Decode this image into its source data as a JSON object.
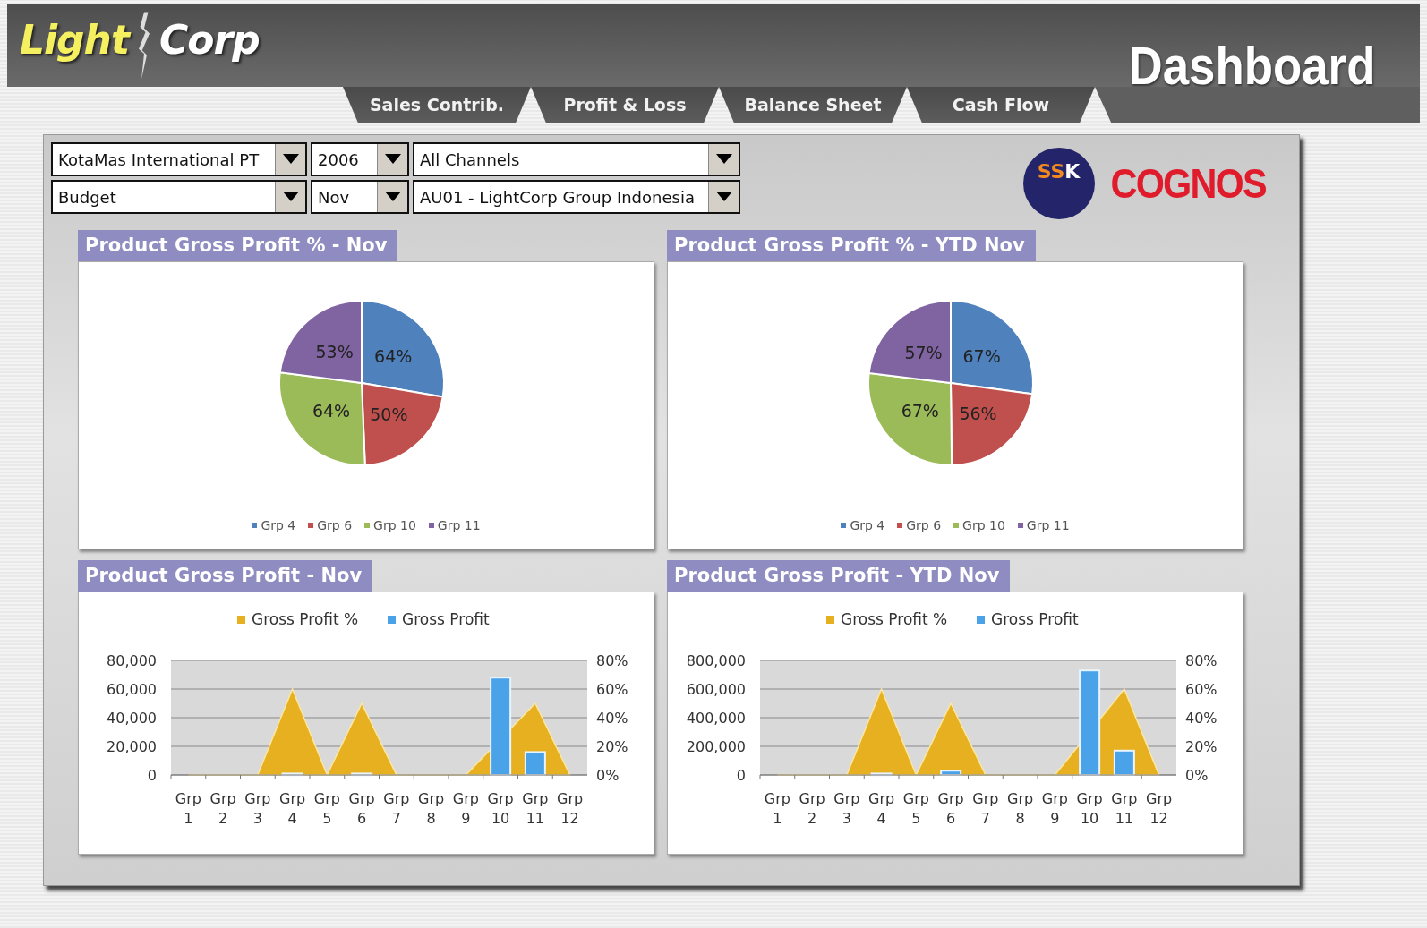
{
  "brand": {
    "first": "Light",
    "second": "Corp"
  },
  "title": "Dashboard",
  "tabs": [
    {
      "label": "Sales Contrib."
    },
    {
      "label": "Profit & Loss"
    },
    {
      "label": "Balance Sheet"
    },
    {
      "label": "Cash Flow"
    }
  ],
  "filters": [
    {
      "value": "KotaMas International PT"
    },
    {
      "value": "2006"
    },
    {
      "value": "All Channels"
    },
    {
      "value": "Budget"
    },
    {
      "value": "Nov"
    },
    {
      "value": "AU01 - LightCorp Group Indonesia"
    }
  ],
  "partner_logos": [
    {
      "kind": "circle",
      "text": "SSK"
    },
    {
      "kind": "wordmark",
      "text": "COGNOS"
    }
  ],
  "panels": [
    {
      "title": "Product Gross Profit % - Nov",
      "chart_data": {
        "type": "pie",
        "categories": [
          "Grp 4",
          "Grp 6",
          "Grp 10",
          "Grp 11"
        ],
        "values": [
          64,
          50,
          64,
          53
        ],
        "legend": "bottom",
        "value_labels": [
          "64%",
          "50%",
          "64%",
          "53%"
        ],
        "colors": [
          "#4f81bd",
          "#c0504d",
          "#9bbb59",
          "#8064a2"
        ]
      }
    },
    {
      "title": "Product Gross Profit % - YTD Nov",
      "chart_data": {
        "type": "pie",
        "categories": [
          "Grp 4",
          "Grp 6",
          "Grp 10",
          "Grp 11"
        ],
        "values": [
          67,
          56,
          67,
          57
        ],
        "legend": "bottom",
        "value_labels": [
          "67%",
          "56%",
          "67%",
          "57%"
        ],
        "colors": [
          "#4f81bd",
          "#c0504d",
          "#9bbb59",
          "#8064a2"
        ]
      }
    },
    {
      "title": "Product Gross Profit - Nov",
      "chart_data": {
        "type": "bar",
        "categories": [
          "Grp 1",
          "Grp 2",
          "Grp 3",
          "Grp 4",
          "Grp 5",
          "Grp 6",
          "Grp 7",
          "Grp 8",
          "Grp 9",
          "Grp 10",
          "Grp 11",
          "Grp 12"
        ],
        "ylim": [
          0,
          80000
        ],
        "yticks": [
          {
            "value": 0,
            "label": "0"
          },
          {
            "value": 20000,
            "label": "20,000"
          },
          {
            "value": 40000,
            "label": "40,000"
          },
          {
            "value": 60000,
            "label": "60,000"
          },
          {
            "value": 80000,
            "label": "80,000"
          }
        ],
        "y2lim": [
          0,
          0.8
        ],
        "y2ticks": [
          {
            "value": 0,
            "label": "0%"
          },
          {
            "value": 0.2,
            "label": "20%"
          },
          {
            "value": 0.4,
            "label": "40%"
          },
          {
            "value": 0.6,
            "label": "60%"
          },
          {
            "value": 0.8,
            "label": "80%"
          }
        ],
        "series": [
          {
            "name": "Gross Profit %",
            "color": "#e6b020",
            "type": "area",
            "axis": "y2",
            "values": [
              0,
              0,
              0,
              0.6,
              0,
              0.5,
              0,
              0,
              0,
              null,
              0.5,
              0
            ]
          },
          {
            "name": "Gross Profit",
            "color": "#4aa3e8",
            "type": "bar",
            "values": [
              0,
              0,
              0,
              1000,
              0,
              1000,
              0,
              0,
              0,
              68000,
              16000,
              0
            ]
          }
        ],
        "legend": "top",
        "grid": true
      }
    },
    {
      "title": "Product Gross Profit - YTD Nov",
      "chart_data": {
        "type": "bar",
        "categories": [
          "Grp 1",
          "Grp 2",
          "Grp 3",
          "Grp 4",
          "Grp 5",
          "Grp 6",
          "Grp 7",
          "Grp 8",
          "Grp 9",
          "Grp 10",
          "Grp 11",
          "Grp 12"
        ],
        "ylim": [
          0,
          800000
        ],
        "yticks": [
          {
            "value": 0,
            "label": "0"
          },
          {
            "value": 200000,
            "label": "200,000"
          },
          {
            "value": 400000,
            "label": "400,000"
          },
          {
            "value": 600000,
            "label": "600,000"
          },
          {
            "value": 800000,
            "label": "800,000"
          }
        ],
        "y2lim": [
          0,
          0.8
        ],
        "y2ticks": [
          {
            "value": 0,
            "label": "0%"
          },
          {
            "value": 0.2,
            "label": "20%"
          },
          {
            "value": 0.4,
            "label": "40%"
          },
          {
            "value": 0.6,
            "label": "60%"
          },
          {
            "value": 0.8,
            "label": "80%"
          }
        ],
        "series": [
          {
            "name": "Gross Profit %",
            "color": "#e6b020",
            "type": "area",
            "axis": "y2",
            "values": [
              0,
              0,
              0,
              0.6,
              0,
              0.5,
              0,
              0,
              0,
              null,
              0.6,
              0
            ]
          },
          {
            "name": "Gross Profit",
            "color": "#4aa3e8",
            "type": "bar",
            "values": [
              0,
              0,
              0,
              10000,
              0,
              30000,
              0,
              0,
              0,
              730000,
              170000,
              0
            ]
          }
        ],
        "legend": "top",
        "grid": true
      }
    }
  ]
}
